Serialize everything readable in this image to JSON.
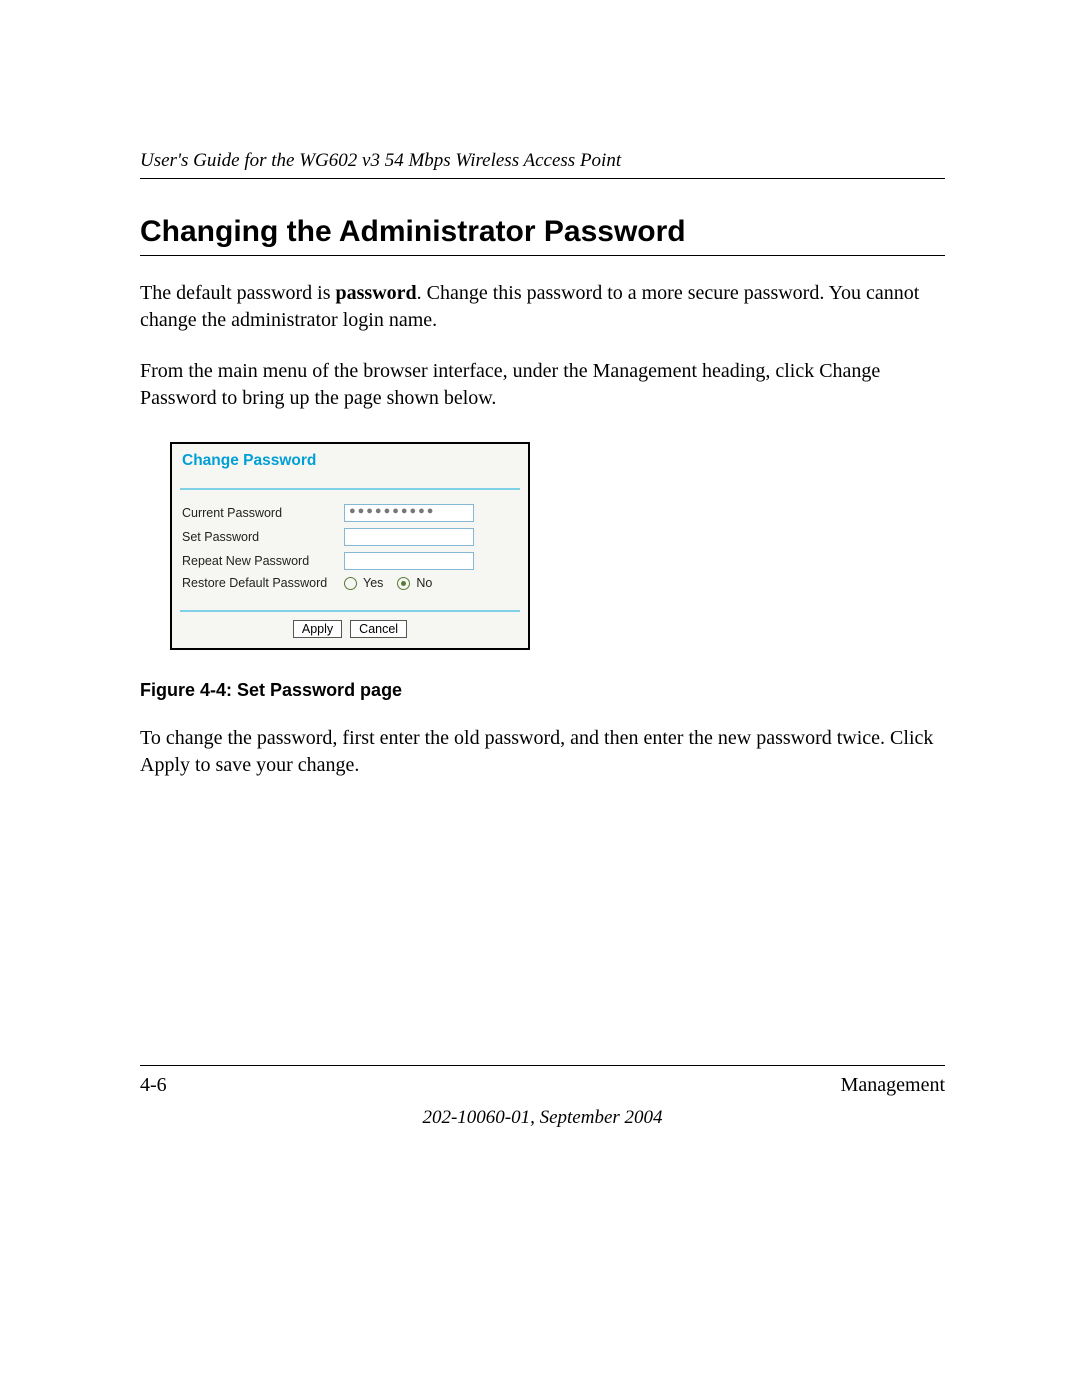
{
  "header": {
    "running_title": "User's Guide for the WG602 v3 54 Mbps Wireless Access Point"
  },
  "section": {
    "title": "Changing the Administrator Password"
  },
  "paragraphs": {
    "p1_a": "The default password is ",
    "p1_b": "password",
    "p1_c": ". Change this password to a more secure password. You cannot change the administrator login name.",
    "p2": "From the main menu of the browser interface, under the Management heading, click Change Password to bring up the page shown below.",
    "p3": "To change the password, first enter the old password, and then enter the new password twice. Click Apply to save your change."
  },
  "dialog": {
    "title": "Change Password",
    "labels": {
      "current": "Current Password",
      "set": "Set Password",
      "repeat": "Repeat New Password",
      "restore": "Restore Default Password"
    },
    "current_value": "●●●●●●●●●●",
    "radio": {
      "yes": "Yes",
      "no": "No",
      "selected": "no"
    },
    "buttons": {
      "apply": "Apply",
      "cancel": "Cancel"
    }
  },
  "figure": {
    "caption": "Figure 4-4:  Set Password page"
  },
  "footer": {
    "page_number": "4-6",
    "section_name": "Management",
    "doc_id": "202-10060-01, September 2004"
  }
}
